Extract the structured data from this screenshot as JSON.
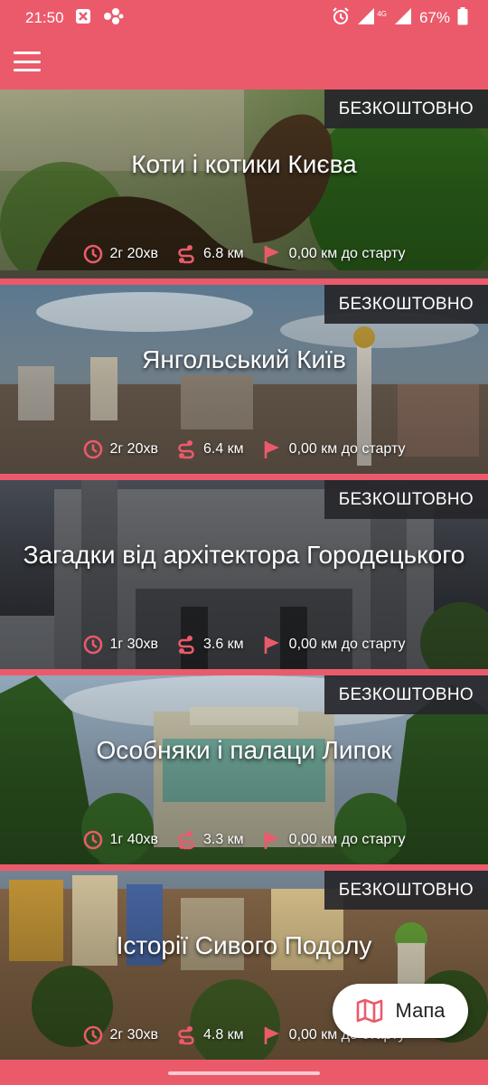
{
  "status_bar": {
    "time": "21:50",
    "network": "4G",
    "battery": "67%",
    "icons": [
      "close-box-icon",
      "share-icon",
      "alarm-icon",
      "signal-icon",
      "signal-icon",
      "battery-icon"
    ]
  },
  "app_bar": {
    "menu_icon": "hamburger-menu-icon"
  },
  "colors": {
    "accent": "#eb5a6b",
    "badge_bg": "#26262a",
    "icon_accent": "#eb5a6b"
  },
  "tours": [
    {
      "title": "Коти і котики Києва",
      "price": "БЕЗКОШТОВНО",
      "duration": "2г 20хв",
      "distance": "6.8 км",
      "to_start": "0,00 км до старту"
    },
    {
      "title": "Янгольський Київ",
      "price": "БЕЗКОШТОВНО",
      "duration": "2г 20хв",
      "distance": "6.4 км",
      "to_start": "0,00 км до старту"
    },
    {
      "title": "Загадки від архітектора Городецького",
      "price": "БЕЗКОШТОВНО",
      "duration": "1г 30хв",
      "distance": "3.6 км",
      "to_start": "0,00 км до старту"
    },
    {
      "title": "Особняки і палаци Липок",
      "price": "БЕЗКОШТОВНО",
      "duration": "1г 40хв",
      "distance": "3.3 км",
      "to_start": "0,00 км до старту"
    },
    {
      "title": "Історії Сивого Подолу",
      "price": "БЕЗКОШТОВНО",
      "duration": "2г 30хв",
      "distance": "4.8 км",
      "to_start": "0,00 км до старту"
    }
  ],
  "map_button": {
    "label": "Мапа",
    "icon": "map-icon"
  }
}
